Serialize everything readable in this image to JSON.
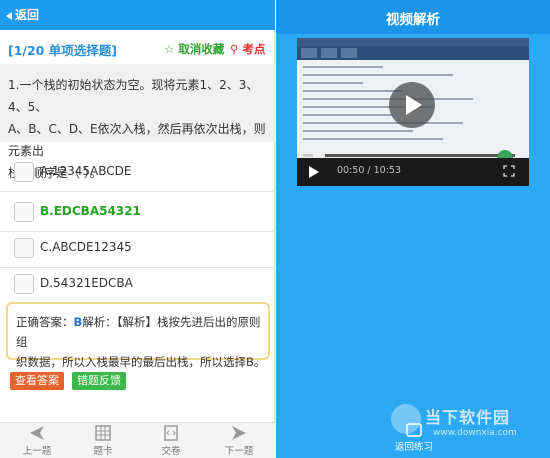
{
  "left": {
    "back_label": "返回",
    "question_type": "[1/20 单项选择题]",
    "favorite_label": "取消收藏",
    "exam_point_label": "考点",
    "question_lines": [
      "1.一个栈的初始状态为空。现将元素1、2、3、4、5、",
      "A、B、C、D、E依次入栈，然后再依次出栈，则元素出",
      "栈的顺序是（    ）。"
    ],
    "options": [
      {
        "text": "A.12345ABCDE",
        "correct": false
      },
      {
        "text": "B.EDCBA54321",
        "correct": true
      },
      {
        "text": "C.ABCDE12345",
        "correct": false
      },
      {
        "text": "D.54321EDCBA",
        "correct": false
      }
    ],
    "answer": {
      "prefix": "正确答案：",
      "letter": "B",
      "line1": "解析：【解析】栈按先进后出的原则组",
      "line2": "织数据，所以入栈最早的最后出栈，所以选择B。"
    },
    "view_answer_label": "查看答案",
    "error_feedback_label": "错题反馈",
    "bottom_nav": [
      {
        "label": "上一题",
        "icon": "arrow-left-icon"
      },
      {
        "label": "题卡",
        "icon": "grid-card-icon"
      },
      {
        "label": "交卷",
        "icon": "submit-paper-icon"
      },
      {
        "label": "下一题",
        "icon": "arrow-right-icon"
      }
    ]
  },
  "right": {
    "title": "视频解析",
    "video_time": "00:50 / 10:53",
    "video_progress": 0.077,
    "practice_label": "返回练习"
  },
  "watermark": {
    "name": "当下软件园",
    "url": "www.downxia.com"
  },
  "colors": {
    "accent_blue": "#1e9bf0",
    "correct_green": "#26a326",
    "view_answer_orange": "#e8622c",
    "feedback_green": "#3cb84a"
  }
}
